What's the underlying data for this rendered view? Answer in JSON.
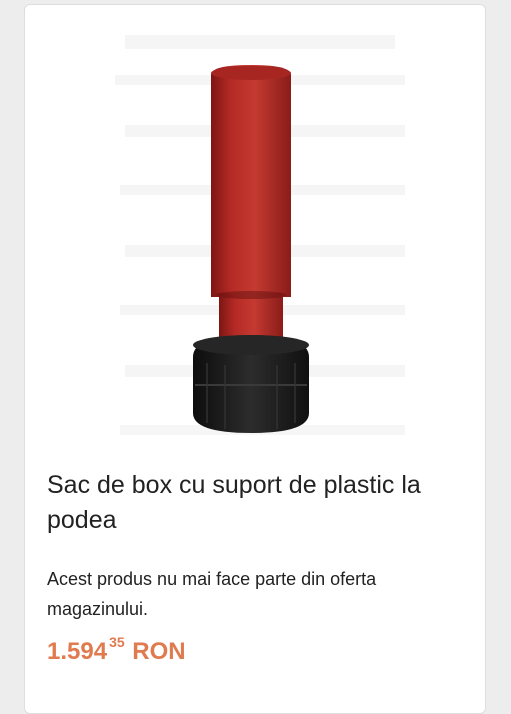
{
  "product": {
    "title": "Sac de box cu suport de plastic la podea",
    "description": "Acest produs nu mai face parte din oferta magazinului.",
    "price": {
      "integer": "1.594",
      "cents": "35",
      "currency": "RON"
    },
    "image_subject": "free-standing-punching-bag"
  },
  "colors": {
    "price": "#e07a4f",
    "bag_red": "#b72a26",
    "base_black": "#1c1c1c"
  }
}
